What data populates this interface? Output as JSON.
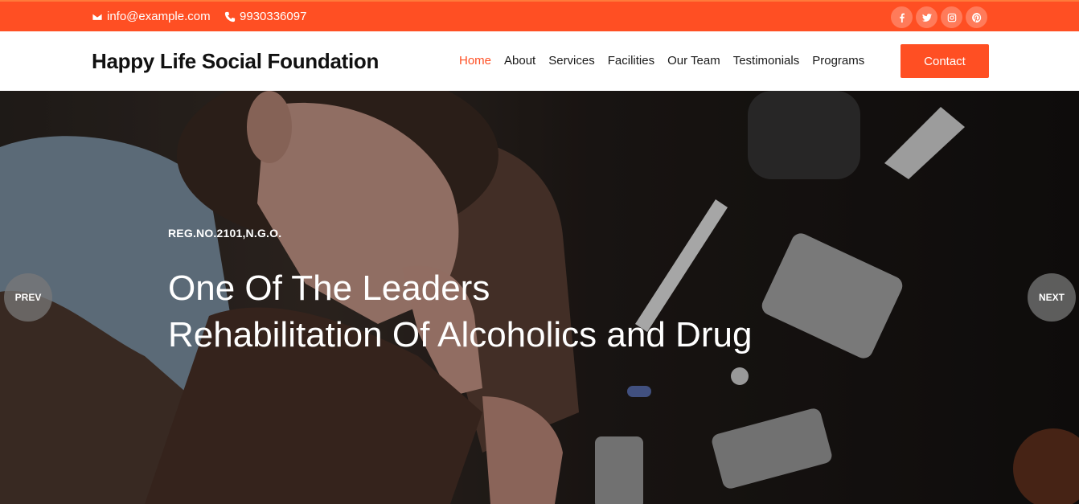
{
  "topbar": {
    "email": "info@example.com",
    "phone": "9930336097",
    "social": [
      {
        "icon": "facebook-icon"
      },
      {
        "icon": "twitter-icon"
      },
      {
        "icon": "instagram-icon"
      },
      {
        "icon": "pinterest-icon"
      }
    ],
    "color": "#ff4f23"
  },
  "navbar": {
    "brand": "Happy Life Social Foundation",
    "items": [
      {
        "label": "Home",
        "active": true
      },
      {
        "label": "About"
      },
      {
        "label": "Services"
      },
      {
        "label": "Facilities"
      },
      {
        "label": "Our Team"
      },
      {
        "label": "Testimonials"
      },
      {
        "label": "Programs"
      }
    ],
    "contact_label": "Contact",
    "accent": "#ff4f23"
  },
  "hero": {
    "tagline": "REG.NO.2101,N.G.O.",
    "line1": "One Of The Leaders",
    "line2": "Rehabilitation Of Alcoholics and Drug",
    "prev_label": "PREV",
    "next_label": "NEXT"
  }
}
